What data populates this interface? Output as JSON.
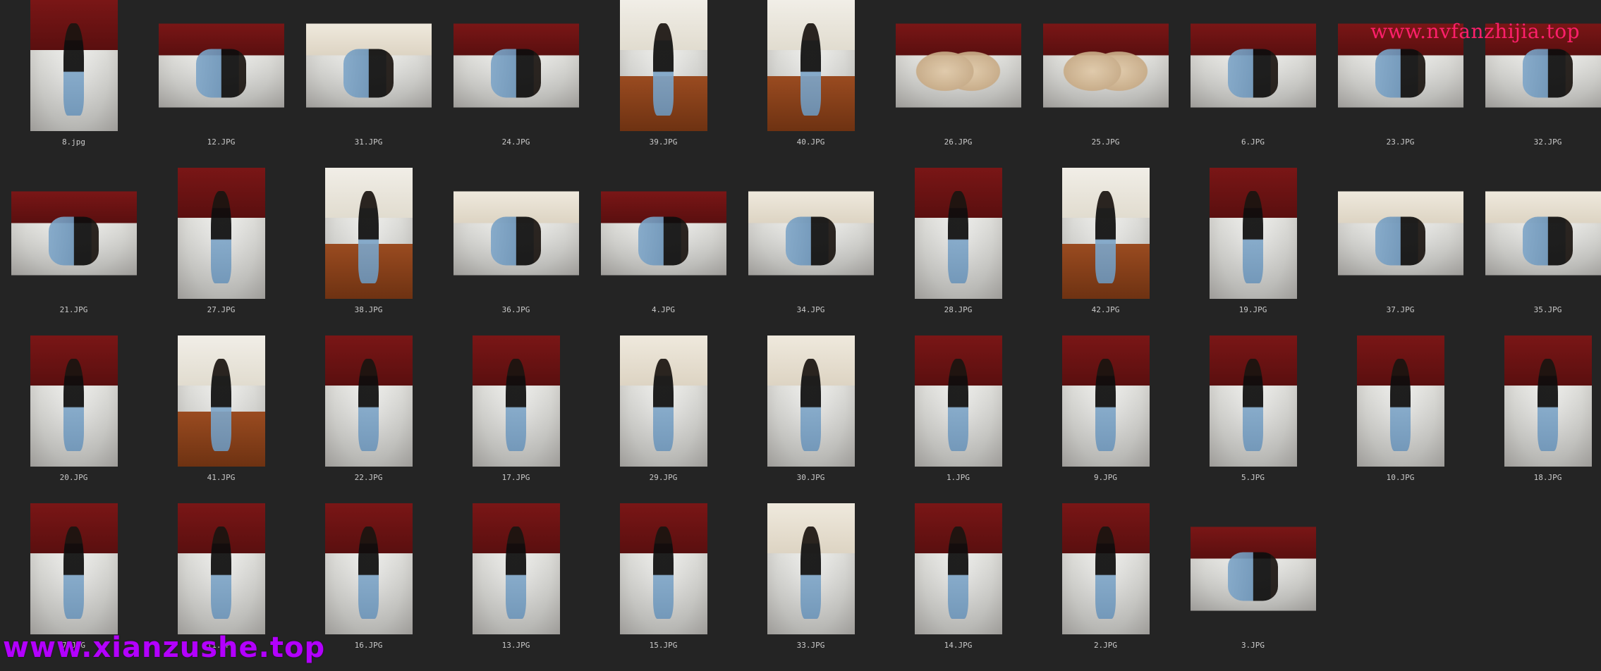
{
  "watermarks": {
    "top_right": "www.nvfanzhijia.top",
    "bottom_left": "www.xianzushe.top"
  },
  "colors": {
    "background": "#242424",
    "label_text": "#c9c9c9",
    "watermark_top": "#ff1f6b",
    "watermark_bottom": "#b300ff"
  },
  "rows": [
    [
      {
        "label": "8.jpg",
        "orientation": "portrait",
        "scene": "bed"
      },
      {
        "label": "12.JPG",
        "orientation": "landscape",
        "scene": "bed"
      },
      {
        "label": "31.JPG",
        "orientation": "landscape",
        "scene": "wall"
      },
      {
        "label": "24.JPG",
        "orientation": "landscape",
        "scene": "bed"
      },
      {
        "label": "39.JPG",
        "orientation": "portrait",
        "scene": "wood"
      },
      {
        "label": "40.JPG",
        "orientation": "portrait",
        "scene": "wood"
      },
      {
        "label": "26.JPG",
        "orientation": "landscape",
        "scene": "closeup"
      },
      {
        "label": "25.JPG",
        "orientation": "landscape",
        "scene": "closeup"
      },
      {
        "label": "6.JPG",
        "orientation": "landscape",
        "scene": "bed"
      },
      {
        "label": "23.JPG",
        "orientation": "landscape",
        "scene": "bed"
      },
      {
        "label": "32.JPG",
        "orientation": "landscape",
        "scene": "bed"
      }
    ],
    [
      {
        "label": "21.JPG",
        "orientation": "landscape",
        "scene": "bed"
      },
      {
        "label": "27.JPG",
        "orientation": "portrait",
        "scene": "bed"
      },
      {
        "label": "38.JPG",
        "orientation": "portrait",
        "scene": "wood"
      },
      {
        "label": "36.JPG",
        "orientation": "landscape",
        "scene": "wall"
      },
      {
        "label": "4.JPG",
        "orientation": "landscape",
        "scene": "bed"
      },
      {
        "label": "34.JPG",
        "orientation": "landscape",
        "scene": "wall"
      },
      {
        "label": "28.JPG",
        "orientation": "portrait",
        "scene": "bed"
      },
      {
        "label": "42.JPG",
        "orientation": "portrait",
        "scene": "wood"
      },
      {
        "label": "19.JPG",
        "orientation": "portrait",
        "scene": "bed"
      },
      {
        "label": "37.JPG",
        "orientation": "landscape",
        "scene": "wall"
      },
      {
        "label": "35.JPG",
        "orientation": "landscape",
        "scene": "wall"
      }
    ],
    [
      {
        "label": "20.JPG",
        "orientation": "portrait",
        "scene": "bed"
      },
      {
        "label": "41.JPG",
        "orientation": "portrait",
        "scene": "wood"
      },
      {
        "label": "22.JPG",
        "orientation": "portrait",
        "scene": "bed"
      },
      {
        "label": "17.JPG",
        "orientation": "portrait",
        "scene": "bed"
      },
      {
        "label": "29.JPG",
        "orientation": "portrait",
        "scene": "wall"
      },
      {
        "label": "30.JPG",
        "orientation": "portrait",
        "scene": "wall"
      },
      {
        "label": "1.JPG",
        "orientation": "portrait",
        "scene": "bed"
      },
      {
        "label": "9.JPG",
        "orientation": "portrait",
        "scene": "bed"
      },
      {
        "label": "5.JPG",
        "orientation": "portrait",
        "scene": "bed"
      },
      {
        "label": "10.JPG",
        "orientation": "portrait",
        "scene": "bed"
      },
      {
        "label": "18.JPG",
        "orientation": "portrait",
        "scene": "bed"
      }
    ],
    [
      {
        "label": "7.JPG",
        "orientation": "portrait",
        "scene": "bed"
      },
      {
        "label": "11.JPG",
        "orientation": "portrait",
        "scene": "bed"
      },
      {
        "label": "16.JPG",
        "orientation": "portrait",
        "scene": "bed"
      },
      {
        "label": "13.JPG",
        "orientation": "portrait",
        "scene": "bed"
      },
      {
        "label": "15.JPG",
        "orientation": "portrait",
        "scene": "bed"
      },
      {
        "label": "33.JPG",
        "orientation": "portrait",
        "scene": "wall"
      },
      {
        "label": "14.JPG",
        "orientation": "portrait",
        "scene": "bed"
      },
      {
        "label": "2.JPG",
        "orientation": "portrait",
        "scene": "bed"
      },
      {
        "label": "3.JPG",
        "orientation": "landscape",
        "scene": "bed"
      }
    ]
  ]
}
